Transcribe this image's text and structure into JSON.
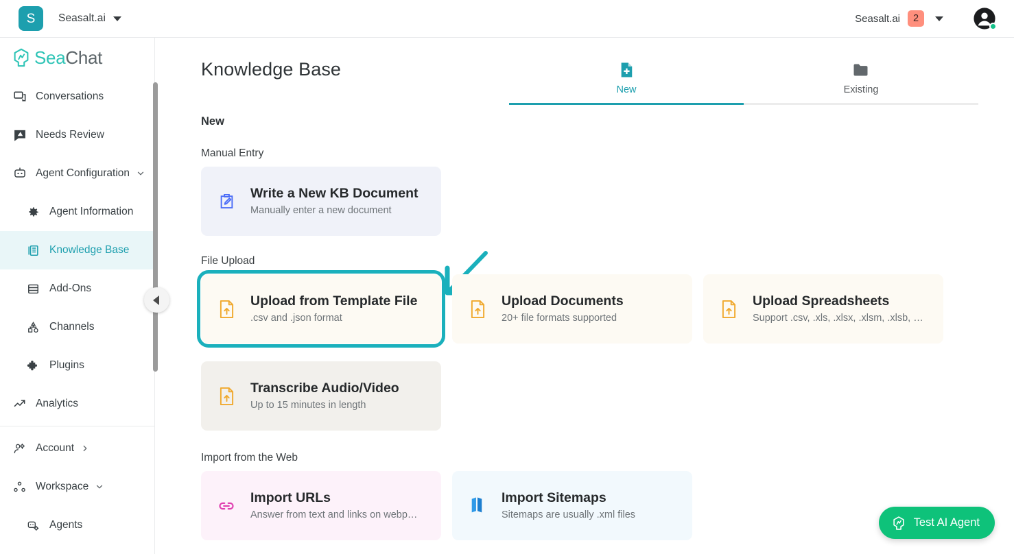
{
  "topbar": {
    "brand_initial": "S",
    "org_name": "Seasalt.ai",
    "account_name": "Seasalt.ai",
    "notification_count": "2",
    "icons": {
      "app_caret": "chevron-down-icon",
      "account_caret": "chevron-down-icon",
      "avatar": "user-avatar-icon"
    }
  },
  "sidebar": {
    "logo": {
      "part1": "Sea",
      "part2": "Chat"
    },
    "items": [
      {
        "label": "Conversations",
        "icon": "chat-bubbles-icon",
        "level": "top",
        "active": false,
        "chevron": ""
      },
      {
        "label": "Needs Review",
        "icon": "flag-message-icon",
        "level": "top",
        "active": false,
        "chevron": ""
      },
      {
        "label": "Agent Configuration",
        "icon": "robot-icon",
        "level": "top",
        "active": false,
        "chevron": "chevron-down-icon"
      },
      {
        "label": "Agent Information",
        "icon": "gear-icon",
        "level": "sub",
        "active": false,
        "chevron": ""
      },
      {
        "label": "Knowledge Base",
        "icon": "book-icon",
        "level": "sub",
        "active": true,
        "chevron": ""
      },
      {
        "label": "Add-Ons",
        "icon": "layers-icon",
        "level": "sub",
        "active": false,
        "chevron": ""
      },
      {
        "label": "Channels",
        "icon": "share-nodes-icon",
        "level": "sub",
        "active": false,
        "chevron": ""
      },
      {
        "label": "Plugins",
        "icon": "puzzle-piece-icon",
        "level": "sub",
        "active": false,
        "chevron": ""
      },
      {
        "label": "Analytics",
        "icon": "trend-up-icon",
        "level": "top",
        "active": false,
        "chevron": ""
      }
    ],
    "footer_items": [
      {
        "label": "Account",
        "icon": "user-gear-icon",
        "level": "top",
        "chevron": "chevron-right-icon"
      },
      {
        "label": "Workspace",
        "icon": "nodes-icon",
        "level": "top",
        "chevron": "chevron-down-icon"
      },
      {
        "label": "Agents",
        "icon": "robot-gear-icon",
        "level": "sub",
        "chevron": ""
      }
    ],
    "collapse_icon": "chevron-left-icon"
  },
  "main": {
    "page_title": "Knowledge Base",
    "tabs": [
      {
        "label": "New",
        "icon": "file-plus-icon",
        "active": true
      },
      {
        "label": "Existing",
        "icon": "folder-icon",
        "active": false
      }
    ],
    "section_heading": "New",
    "groups": [
      {
        "label": "Manual Entry",
        "cards": [
          {
            "title": "Write a New KB Document",
            "subtitle": "Manually enter a new document",
            "icon": "pencil-clipboard-icon",
            "style": "kb-doc",
            "selected": false
          }
        ]
      },
      {
        "label": "File Upload",
        "cards": [
          {
            "title": "Upload from Template File",
            "subtitle": ".csv and .json format",
            "icon": "file-upload-icon",
            "style": "upload",
            "selected": true
          },
          {
            "title": "Upload Documents",
            "subtitle": "20+ file formats supported",
            "icon": "file-upload-icon",
            "style": "upload",
            "selected": false
          },
          {
            "title": "Upload Spreadsheets",
            "subtitle": "Support .csv, .xls, .xlsx, .xlsm, .xlsb, …",
            "icon": "file-upload-icon",
            "style": "upload",
            "selected": false
          }
        ]
      },
      {
        "label": "",
        "cards": [
          {
            "title": "Transcribe Audio/Video",
            "subtitle": "Up to 15 minutes in length",
            "icon": "file-upload-icon",
            "style": "transcribe",
            "selected": false
          }
        ]
      },
      {
        "label": "Import from the Web",
        "cards": [
          {
            "title": "Import URLs",
            "subtitle": "Answer from text and links on webp…",
            "icon": "link-icon",
            "style": "urls",
            "selected": false
          },
          {
            "title": "Import Sitemaps",
            "subtitle": "Sitemaps are usually .xml files",
            "icon": "map-icon",
            "style": "sitemaps",
            "selected": false
          }
        ]
      }
    ]
  },
  "floating": {
    "test_agent_label": "Test AI Agent",
    "test_agent_icon": "seachat-logo-icon"
  },
  "colors": {
    "accent_teal": "#1d9fae",
    "highlight_teal": "#1ab0bc",
    "badge_salmon": "#ff8f7d",
    "green_button": "#0ec27a",
    "upload_icon_orange": "#f0a92e",
    "kb_icon_blue": "#4a6cf7",
    "url_icon_magenta": "#e040b0",
    "map_icon_blue": "#2f9ae8"
  }
}
